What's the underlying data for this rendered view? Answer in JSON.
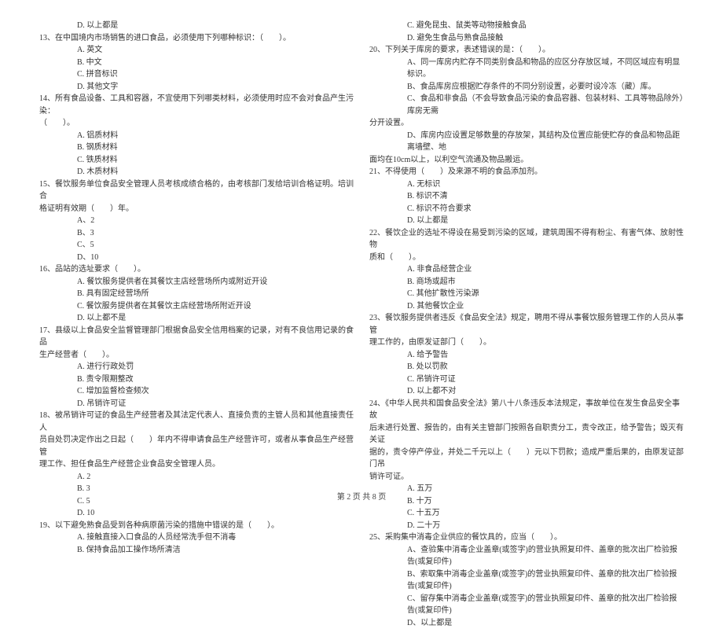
{
  "left": {
    "q12_d": "D. 以上都是",
    "q13": "13、在中国境内市场销售的进口食品，必须使用下列哪种标识：（　　）。",
    "q13_a": "A. 英文",
    "q13_b": "B. 中文",
    "q13_c": "C. 拼音标识",
    "q13_d": "D. 其他文字",
    "q14": "14、所有食品设备、工具和容器，不宜使用下列哪类材料，必须使用时应不会对食品产生污染：",
    "q14_cont": "（　　）。",
    "q14_a": "A. 铝质材料",
    "q14_b": "B. 钢质材料",
    "q14_c": "C. 铁质材料",
    "q14_d": "D. 木质材料",
    "q15": "15、餐饮服务单位食品安全管理人员考核成绩合格的，由考核部门发给培训合格证明。培训合",
    "q15_cont": "格证明有效期（　　）年。",
    "q15_a": "A、2",
    "q15_b": "B、3",
    "q15_c": "C、5",
    "q15_d": "D、10",
    "q16": "16、品站的选址要求（　　）。",
    "q16_a": "A. 餐饮服务提供者在其餐饮主店经营场所内或附近开设",
    "q16_b": "B. 具有固定经营场所",
    "q16_c": "C. 餐饮服务提供者在其餐饮主店经营场所附近开设",
    "q16_d": "D. 以上都不是",
    "q17": "17、县级以上食品安全监督管理部门根据食品安全信用档案的记录，对有不良信用记录的食品",
    "q17_cont": "生产经营者（　　）。",
    "q17_a": "A. 进行行政处罚",
    "q17_b": "B. 责令限期整改",
    "q17_c": "C. 增加监督检查频次",
    "q17_d": "D. 吊销许可证",
    "q18": "18、被吊销许可证的食品生产经营者及其法定代表人、直接负责的主管人员和其他直接责任人",
    "q18_cont": "员自处罚决定作出之日起（　　）年内不得申请食品生产经营许可，或者从事食品生产经营管",
    "q18_cont2": "理工作、担任食品生产经营企业食品安全管理人员。",
    "q18_a": "A. 2",
    "q18_b": "B. 3",
    "q18_c": "C. 5",
    "q18_d": "D. 10",
    "q19": "19、以下避免熟食品受到各种病原菌污染的措施中错误的是（　　）。",
    "q19_a": "A. 接触直接入口食品的人员经常洗手但不消毒",
    "q19_b": "B. 保持食品加工操作场所清洁"
  },
  "right": {
    "q19_c": "C. 避免昆虫、鼠类等动物接触食品",
    "q19_d": "D. 避免生食品与熟食品接触",
    "q20": "20、下列关于库房的要求，表述错误的是：（　　）。",
    "q20_a": "A、同一库房内贮存不同类别食品和物品的应区分存放区域，不同区域应有明显标识。",
    "q20_b": "B、食品库房应根据贮存条件的不同分别设置，必要时设冷冻（藏）库。",
    "q20_c": "C、食品和非食品（不会导致食品污染的食品容器、包装材料、工具等物品除外）库房无需",
    "q20_c_cont": "分开设置。",
    "q20_d": "D、库房内应设置足够数量的存放架，其结构及位置应能使贮存的食品和物品距离墙壁、地",
    "q20_d_cont": "面均在10cm以上，以利空气流通及物品搬运。",
    "q21": "21、不得使用（　　）及来源不明的食品添加剂。",
    "q21_a": "A. 无标识",
    "q21_b": "B. 标识不清",
    "q21_c": "C. 标识不符合要求",
    "q21_d": "D. 以上都是",
    "q22": "22、餐饮企业的选址不得设在易受到污染的区域，建筑周围不得有粉尘、有害气体、放射性物",
    "q22_cont": "质和（　　）。",
    "q22_a": "A. 非食品经营企业",
    "q22_b": "B. 商场或超市",
    "q22_c": "C. 其他扩散性污染源",
    "q22_d": "D. 其他餐饮企业",
    "q23": "23、餐饮服务提供者违反《食品安全法》规定，聘用不得从事餐饮服务管理工作的人员从事管",
    "q23_cont": "理工作的，由原发证部门（　　）。",
    "q23_a": "A. 给予警告",
    "q23_b": "B. 处以罚款",
    "q23_c": "C. 吊销许可证",
    "q23_d": "D. 以上都不对",
    "q24": "24、《中华人民共和国食品安全法》第八十八条违反本法规定，事故单位在发生食品安全事故",
    "q24_cont": "后未进行处置、报告的，由有关主管部门按照各自职责分工，责令改正，给予警告；毁灭有关证",
    "q24_cont2": "据的，责令停产停业，并处二千元以上（　　）元以下罚款；造成严重后果的，由原发证部门吊",
    "q24_cont3": "销许可证。",
    "q24_a": "A. 五万",
    "q24_b": "B. 十万",
    "q24_c": "C. 十五万",
    "q24_d": "D. 二十万",
    "q25": "25、采购集中消毒企业供应的餐饮具的，应当（　　）。",
    "q25_a": "A、查验集中消毒企业盖章(或签字)的营业执照复印件、盖章的批次出厂检验报告(或复印件)",
    "q25_b": "B、索取集中消毒企业盖章(或签字)的营业执照复印件、盖章的批次出厂检验报告(或复印件)",
    "q25_c": "C、留存集中消毒企业盖章(或签字)的营业执照复印件、盖章的批次出厂检验报告(或复印件)",
    "q25_d": "D、以上都是"
  },
  "footer": "第 2 页 共 8 页"
}
